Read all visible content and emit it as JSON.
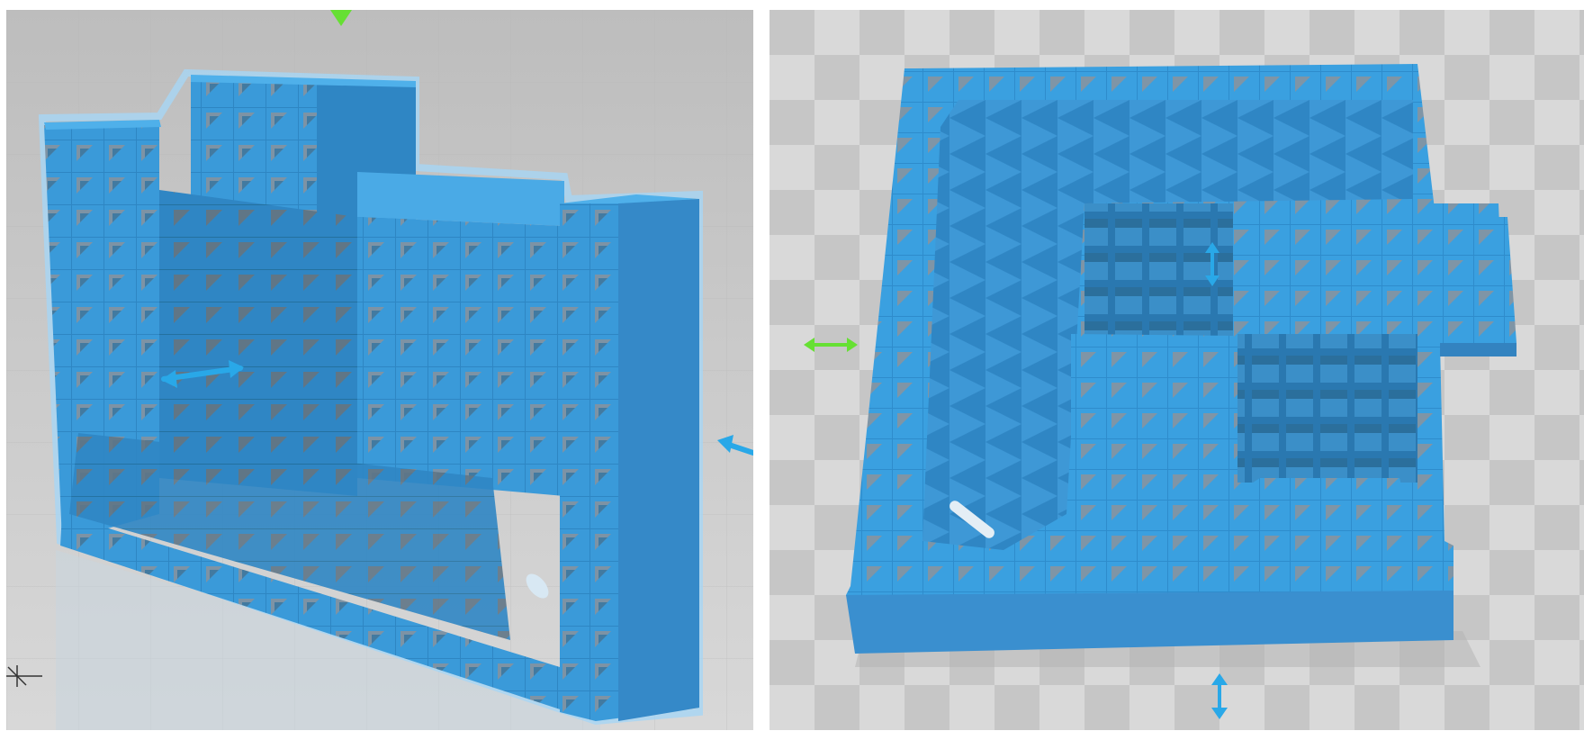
{
  "window": {
    "title": "",
    "description_hidden": true
  },
  "viewports": [
    {
      "id": "left",
      "model": "lattice-wall-part",
      "camera": "front-perspective"
    },
    {
      "id": "right",
      "model": "lattice-maze-part",
      "camera": "top-perspective"
    }
  ],
  "colors": {
    "model_fill": "#3a9ad9",
    "model_top": "#4aaae6",
    "model_side": "#2f86c4",
    "model_dark": "#2672a8",
    "lattice_hole": "#1f5f8f",
    "glow": "#9fd3f5",
    "bed_light": "#d9d9d9",
    "bed_dark": "#c4c4c4",
    "gizmo_green": "#66e033",
    "gizmo_blue": "#29a8e8",
    "background": "#ffffff"
  },
  "icons": {
    "move_x": "double-arrow-horizontal-icon",
    "move_y": "double-arrow-vertical-icon",
    "pivot": "triangle-down-icon",
    "axis_hint": "arrow-left-icon"
  }
}
